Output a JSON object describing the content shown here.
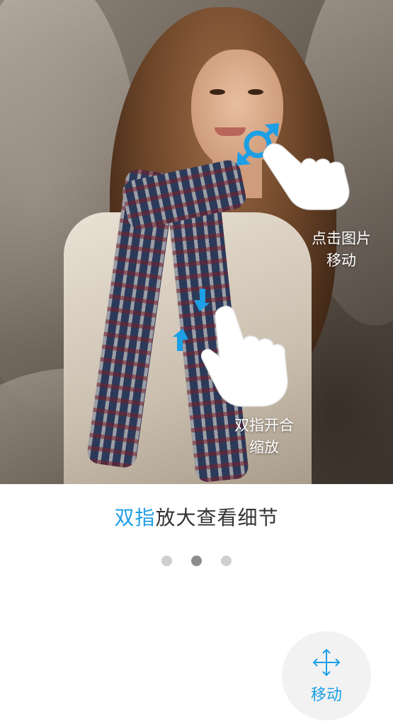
{
  "overlay": {
    "tap_hint_line1": "点击图片",
    "tap_hint_line2": "移动",
    "pinch_hint_line1": "双指开合",
    "pinch_hint_line2": "缩放"
  },
  "caption": {
    "accent_text": "双指",
    "rest_text": "放大查看细节"
  },
  "pager": {
    "total": 3,
    "active_index": 1
  },
  "move_button": {
    "label": "移动",
    "icon": "move-arrows-icon"
  },
  "colors": {
    "accent": "#1d9fe6",
    "caption_text": "#333333",
    "dot_inactive": "#cfcfcf",
    "dot_active": "#8c8c8c",
    "button_bg": "#f2f2f2"
  }
}
